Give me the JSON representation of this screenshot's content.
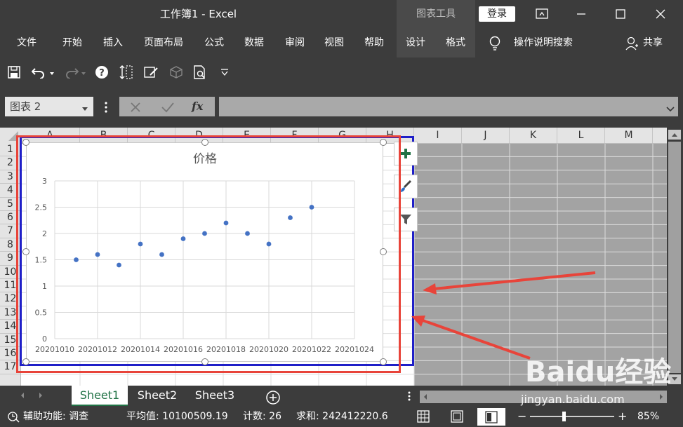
{
  "window": {
    "title": "工作簿1  -  Excel",
    "context_tab_group": "图表工具",
    "login_label": "登录"
  },
  "menu": {
    "items": [
      "文件",
      "开始",
      "插入",
      "页面布局",
      "公式",
      "数据",
      "审阅",
      "视图",
      "帮助",
      "设计",
      "格式"
    ],
    "search_label": "操作说明搜索",
    "share_label": "共享"
  },
  "formula_bar": {
    "name_box": "图表 2",
    "fx_label": "fx",
    "value": ""
  },
  "columns": [
    "A",
    "B",
    "C",
    "D",
    "E",
    "F",
    "G",
    "H",
    "I",
    "J",
    "K",
    "L",
    "M"
  ],
  "rows": [
    "1",
    "2",
    "3",
    "4",
    "5",
    "6",
    "7",
    "8",
    "9",
    "10",
    "11",
    "12",
    "13",
    "14",
    "15",
    "16",
    "17"
  ],
  "chart_data": {
    "type": "scatter",
    "title": "价格",
    "xlabel": "",
    "ylabel": "",
    "x": [
      20201011,
      20201012,
      20201013,
      20201014,
      20201015,
      20201016,
      20201017,
      20201018,
      20201019,
      20201020,
      20201021,
      20201022
    ],
    "y": [
      1.5,
      1.6,
      1.4,
      1.8,
      1.6,
      1.9,
      2.0,
      2.2,
      2.0,
      1.8,
      2.3,
      2.5
    ],
    "xlim": [
      20201010,
      20201024
    ],
    "ylim": [
      0,
      3
    ],
    "xticks": [
      "20201010",
      "20201012",
      "20201014",
      "20201016",
      "20201018",
      "20201020",
      "20201022",
      "20201024"
    ],
    "yticks": [
      "0",
      "0.5",
      "1",
      "1.5",
      "2",
      "2.5",
      "3"
    ],
    "grid": true,
    "legend": "none",
    "point_color": "#4472c4"
  },
  "sheets": [
    "Sheet1",
    "Sheet2",
    "Sheet3"
  ],
  "status": {
    "accessibility": "辅助功能: 调查",
    "average": "平均值: 10100509.19",
    "count": "计数: 26",
    "sum": "求和: 242412220.6",
    "zoom": "85%"
  },
  "watermark": {
    "brand": "Baidu经验",
    "url": "jingyan.baidu.com"
  },
  "colors": {
    "excel_green": "#217346",
    "annotation_red": "#e8443a",
    "selection_blue": "#1f1fc8"
  }
}
